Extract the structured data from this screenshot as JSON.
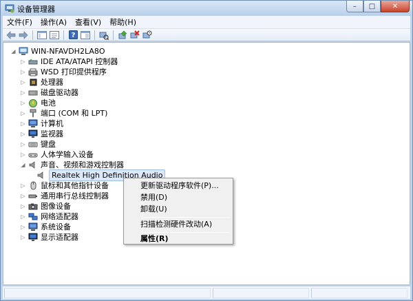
{
  "window": {
    "title": "设备管理器",
    "controls": {
      "minimize": "–",
      "maximize": "□",
      "close": "✕"
    }
  },
  "menubar": {
    "items": [
      "文件(F)",
      "操作(A)",
      "查看(V)",
      "帮助(H)"
    ]
  },
  "toolbar": {
    "buttons": [
      "back",
      "forward",
      "show-hide-tree",
      "properties",
      "help",
      "show-view",
      "scan-hardware",
      "update-driver",
      "uninstall",
      "disable"
    ]
  },
  "tree": {
    "root": "WIN-NFAVDH2LA8O",
    "categories": [
      {
        "label": "IDE ATA/ATAPI 控制器",
        "icon": "ide-controller-icon"
      },
      {
        "label": "WSD 打印提供程序",
        "icon": "printer-icon"
      },
      {
        "label": "处理器",
        "icon": "processor-icon"
      },
      {
        "label": "磁盘驱动器",
        "icon": "disk-drive-icon"
      },
      {
        "label": "电池",
        "icon": "battery-icon"
      },
      {
        "label": "端口 (COM 和 LPT)",
        "icon": "port-icon"
      },
      {
        "label": "计算机",
        "icon": "computer-icon"
      },
      {
        "label": "监视器",
        "icon": "monitor-icon"
      },
      {
        "label": "键盘",
        "icon": "keyboard-icon"
      },
      {
        "label": "人体学输入设备",
        "icon": "hid-icon"
      },
      {
        "label": "声音、视频和游戏控制器",
        "icon": "sound-icon",
        "expanded": true
      },
      {
        "label": "Realtek High Definition Audio",
        "icon": "speaker-icon",
        "child": true,
        "selected": true
      },
      {
        "label": "鼠标和其他指针设备",
        "icon": "mouse-icon"
      },
      {
        "label": "通用串行总线控制器",
        "icon": "usb-icon"
      },
      {
        "label": "图像设备",
        "icon": "camera-icon"
      },
      {
        "label": "网络适配器",
        "icon": "network-icon"
      },
      {
        "label": "系统设备",
        "icon": "system-device-icon"
      },
      {
        "label": "显示适配器",
        "icon": "display-adapter-icon"
      }
    ]
  },
  "context_menu": {
    "update_driver": "更新驱动程序软件(P)...",
    "disable": "禁用(D)",
    "uninstall": "卸载(U)",
    "scan": "扫描检测硬件改动(A)",
    "properties": "属性(R)"
  },
  "colors": {
    "selection": "#dbe9fb",
    "frame": "#bfd3ea",
    "close_button": "#c9432c"
  }
}
